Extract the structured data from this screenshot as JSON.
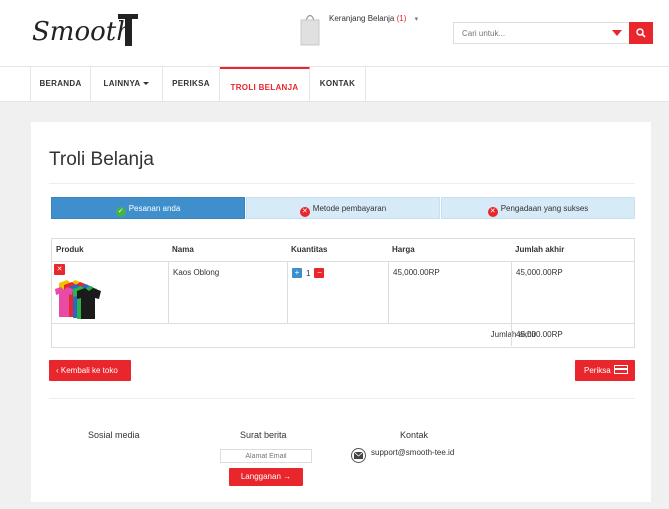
{
  "header": {
    "logo_text": "SmoothT",
    "cart_label": "Keranjang Belanja",
    "cart_count": "(1)",
    "search_placeholder": "Cari untuk..."
  },
  "nav": {
    "items": [
      {
        "label": "BERANDA"
      },
      {
        "label": "LAINNYA"
      },
      {
        "label": "PERIKSA"
      },
      {
        "label": "TROLI BELANJA",
        "active": true
      },
      {
        "label": "KONTAK"
      }
    ]
  },
  "page": {
    "title": "Troli Belanja",
    "steps": [
      {
        "label": "Pesanan anda",
        "state": "done"
      },
      {
        "label": "Metode pembayaran",
        "state": "pending"
      },
      {
        "label": "Pengadaan yang sukses",
        "state": "pending"
      }
    ]
  },
  "cart": {
    "headers": [
      "Produk",
      "Nama",
      "Kuantitas",
      "Harga",
      "Jumlah akhir"
    ],
    "rows": [
      {
        "name": "Kaos Oblong",
        "qty": "1",
        "price": "45,000.00RP",
        "total": "45,000.00RP"
      }
    ],
    "total_label": "Jumlah akhir",
    "total_value": "45,000.00RP"
  },
  "actions": {
    "back_label": "‹ Kembali ke toko",
    "checkout_label": "Periksa"
  },
  "footer": {
    "social_title": "Sosial media",
    "newsletter_title": "Surat berita",
    "email_placeholder": "Alamat Email",
    "subscribe_label": "Langganan →",
    "contact_title": "Kontak",
    "contact_email": "support@smooth-tee.id"
  },
  "colors": {
    "accent": "#e8262b",
    "step_active": "#3f8fcc",
    "step_inactive": "#d6ebf7"
  }
}
